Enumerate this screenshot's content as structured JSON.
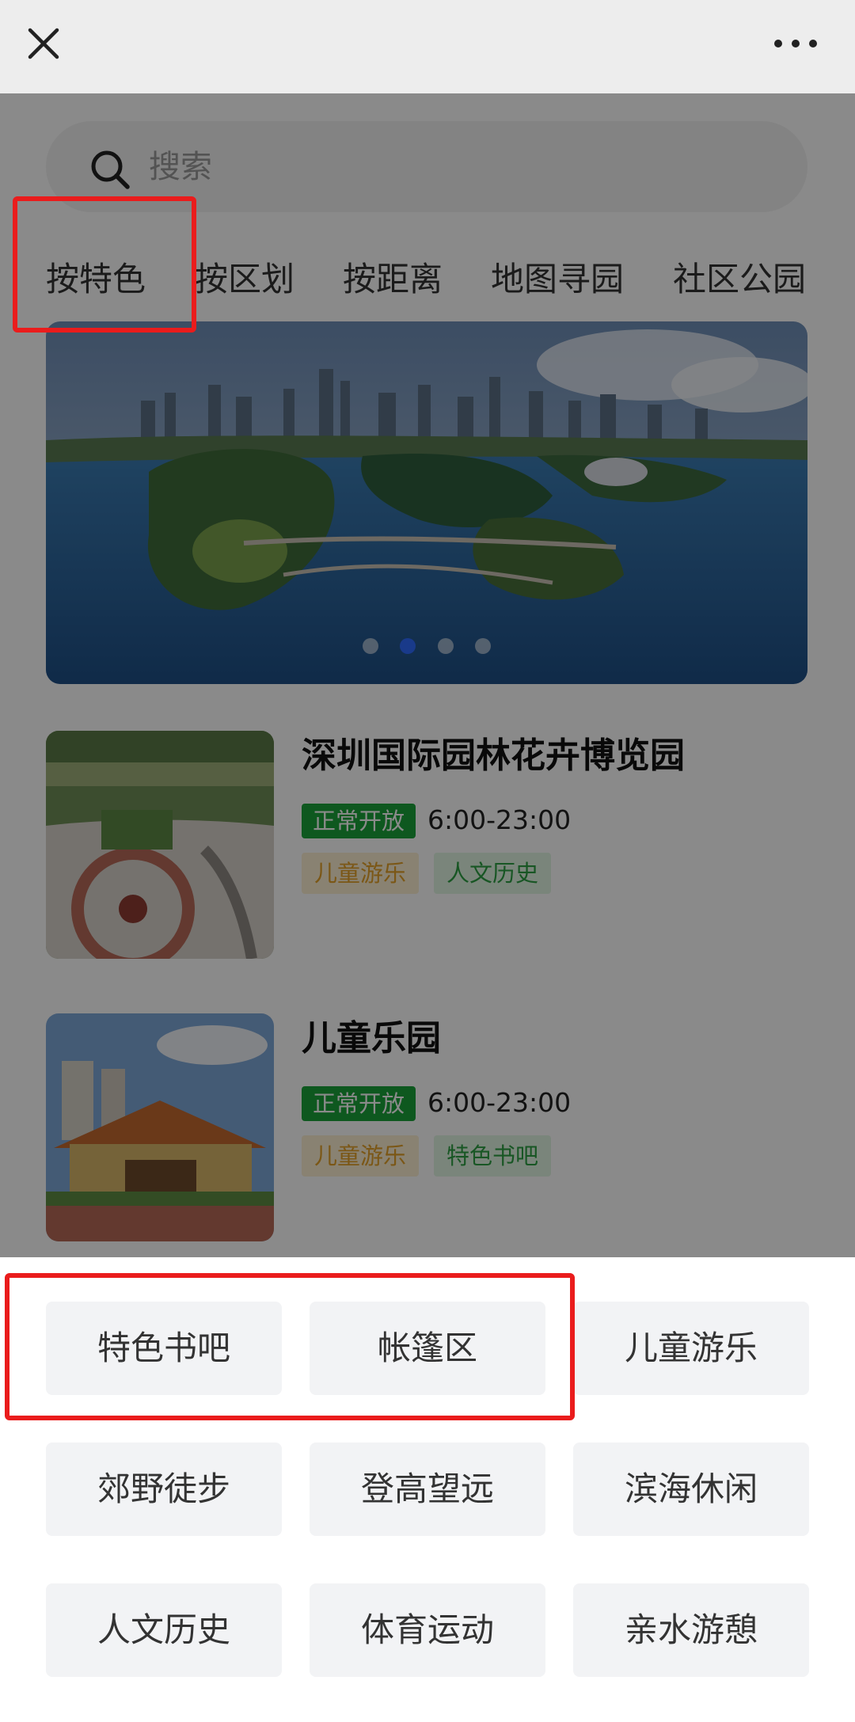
{
  "search": {
    "placeholder": "搜索"
  },
  "tabs": [
    {
      "label": "按特色"
    },
    {
      "label": "按区划"
    },
    {
      "label": "按距离"
    },
    {
      "label": "地图寻园"
    },
    {
      "label": "社区公园"
    }
  ],
  "banner": {
    "dots": 4,
    "active_dot": 2
  },
  "parks": [
    {
      "name": "深圳国际园林花卉博览园",
      "status": "正常开放",
      "hours": "6:00-23:00",
      "tags": [
        {
          "label": "儿童游乐",
          "color": "orange"
        },
        {
          "label": "人文历史",
          "color": "green"
        }
      ]
    },
    {
      "name": "儿童乐园",
      "status": "正常开放",
      "hours": "6:00-23:00",
      "tags": [
        {
          "label": "儿童游乐",
          "color": "orange"
        },
        {
          "label": "特色书吧",
          "color": "green"
        }
      ]
    }
  ],
  "feature_options": [
    "特色书吧",
    "帐篷区",
    "儿童游乐",
    "郊野徒步",
    "登高望远",
    "滨海休闲",
    "人文历史",
    "体育运动",
    "亲水游憩"
  ],
  "colors": {
    "status_green": "#1aa33a",
    "tag_orange_text": "#e3a12a",
    "tag_green_text": "#2ea043",
    "highlight_red": "#ea1c1c",
    "active_dot": "#2f6bff"
  }
}
